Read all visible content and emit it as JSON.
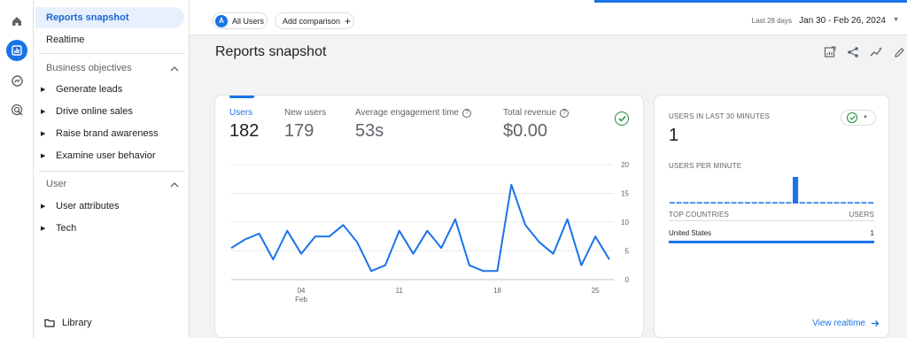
{
  "rail": {
    "icons": [
      "home-icon",
      "reports-icon",
      "explore-icon",
      "advertising-icon"
    ]
  },
  "sidenav": {
    "reports_snapshot": "Reports snapshot",
    "realtime": "Realtime",
    "business_objectives": "Business objectives",
    "business_items": [
      "Generate leads",
      "Drive online sales",
      "Raise brand awareness",
      "Examine user behavior"
    ],
    "user_section": "User",
    "user_items": [
      "User attributes",
      "Tech"
    ],
    "library": "Library"
  },
  "topbar": {
    "segment_avatar": "A",
    "segment_label": "All Users",
    "add_comparison": "Add comparison",
    "date_label": "Last 28 days",
    "date_range": "Jan 30 - Feb 26, 2024"
  },
  "page": {
    "title": "Reports snapshot"
  },
  "metrics": [
    {
      "label": "Users",
      "value": "182"
    },
    {
      "label": "New users",
      "value": "179"
    },
    {
      "label": "Average engagement time",
      "value": "53s"
    },
    {
      "label": "Total revenue",
      "value": "$0.00"
    }
  ],
  "chart_data": {
    "type": "line",
    "x_tick_labels": [
      "04",
      "11",
      "18",
      "25"
    ],
    "x_month_label": "Feb",
    "y_tick_labels": [
      "20",
      "15",
      "10",
      "5",
      "0"
    ],
    "ylim": [
      0,
      20
    ],
    "series": [
      {
        "values": [
          5.5,
          7,
          8,
          3.5,
          8.5,
          4.5,
          7.5,
          7.5,
          9.5,
          6.5,
          1.5,
          2.5,
          8.5,
          4.5,
          8.5,
          5.5,
          10.5,
          2.5,
          1.5,
          1.5,
          16.5,
          9.5,
          6.5,
          4.5,
          10.5,
          2.5,
          7.5,
          3.5
        ]
      }
    ],
    "color": "#1a73e8",
    "grid": true
  },
  "realtime": {
    "title": "USERS IN LAST 30 MINUTES",
    "value": "1",
    "per_minute_label": "USERS PER MINUTE",
    "per_minute_values": [
      0,
      0,
      0,
      0,
      0,
      0,
      0,
      0,
      0,
      0,
      0,
      0,
      0,
      0,
      0,
      0,
      0,
      0,
      1,
      0,
      0,
      0,
      0,
      0,
      0,
      0,
      0,
      0,
      0,
      0
    ],
    "countries_header": "TOP COUNTRIES",
    "users_header": "USERS",
    "rows": [
      {
        "country": "United States",
        "users": "1"
      }
    ],
    "link": "View realtime"
  }
}
